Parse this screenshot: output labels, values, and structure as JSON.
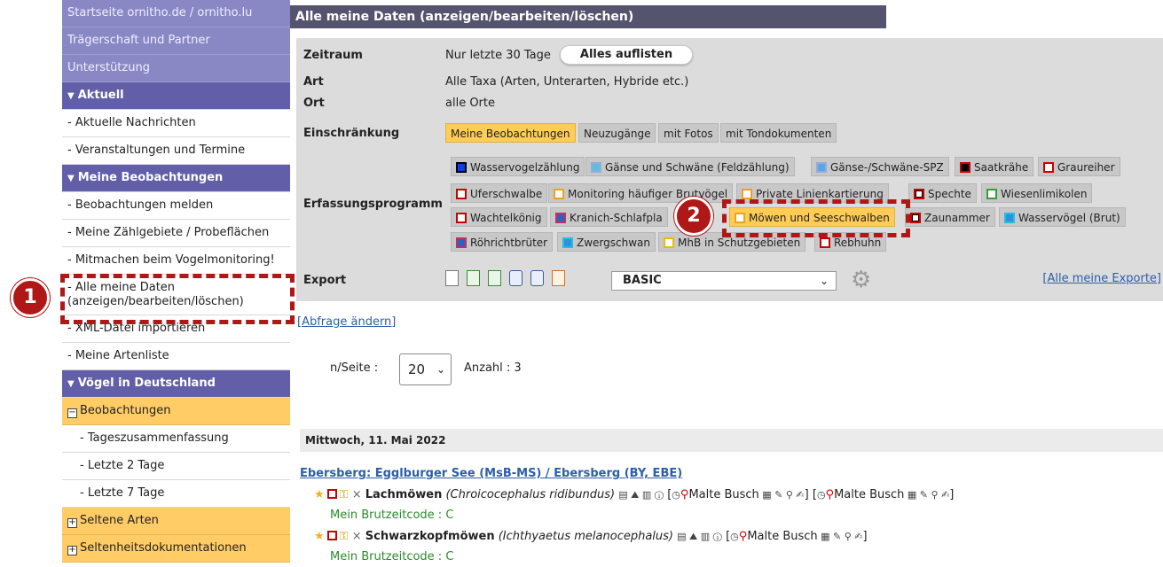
{
  "sidebar": {
    "top_items": [
      "Startseite ornitho.de / ornitho.lu",
      "Trägerschaft und Partner",
      "Unterstützung"
    ],
    "aktuell": {
      "heading": "Aktuell",
      "items": [
        "- Aktuelle Nachrichten",
        "- Veranstaltungen und Termine"
      ]
    },
    "meine": {
      "heading": "Meine Beobachtungen",
      "items": [
        "- Beobachtungen melden",
        "- Meine Zählgebiete / Probeflächen",
        "- Mitmachen beim Vogelmonitoring!",
        "- Alle meine Daten",
        "(anzeigen/bearbeiten/löschen)",
        "- XML-Datei importieren",
        "- Meine Artenliste"
      ]
    },
    "voegel": {
      "heading": "Vögel in Deutschland",
      "beobachtungen": "Beobachtungen",
      "items": [
        "- Tageszusammenfassung",
        "- Letzte 2 Tage",
        "- Letzte 7 Tage"
      ],
      "seltene": "Seltene Arten",
      "seltenheit": "Seltenheitsdokumentationen"
    }
  },
  "main": {
    "title": "Alle meine Daten (anzeigen/bearbeiten/löschen)",
    "filters": {
      "zeitraum_label": "Zeitraum",
      "zeitraum_value": "Nur letzte 30 Tage",
      "zeitraum_button": "Alles auflisten",
      "art_label": "Art",
      "art_value": "Alle Taxa (Arten, Unterarten, Hybride etc.)",
      "ort_label": "Ort",
      "ort_value": "alle Orte",
      "einschraenkung_label": "Einschränkung",
      "einschraenkung_options": [
        "Meine Beobachtungen",
        "Neuzugänge",
        "mit Fotos",
        "mit Tondokumenten"
      ],
      "einschraenkung_active": "Meine Beobachtungen",
      "erfassung_label": "Erfassungsprogramm",
      "programs": {
        "row1": [
          "Wasservogelzählung",
          "Gänse und Schwäne (Feldzählung)",
          "Gänse-/Schwäne-SPZ",
          "Saatkrähe",
          "Graureiher"
        ],
        "row2": [
          "Uferschwalbe",
          "Monitoring häufiger Brutvögel",
          "Private Linienkartierung",
          "Spechte",
          "Wiesenlimikolen"
        ],
        "row3": [
          "Wachtelkönig",
          "Kranich-Schlafpla",
          "Möwen und Seeschwalben",
          "Zaunammer",
          "Wasservögel (Brut)"
        ],
        "row4": [
          "Röhrichtbrüter",
          "Zwergschwan",
          "MhB in Schutzgebieten",
          "Rebhuhn"
        ]
      },
      "program_active": "Möwen und Seeschwalben",
      "export_label": "Export",
      "export_format": "BASIC",
      "all_exports_link": "[Alle meine Exporte]"
    },
    "abfrage_link": "[Abfrage ändern]",
    "per_page_label": "n/Seite :",
    "per_page_value": "20",
    "count_label": "Anzahl : 3",
    "date_header": "Mittwoch, 11. Mai 2022",
    "location": "Ebersberg: Egglburger See (MsB-MS) / Ebersberg (BY, EBE)",
    "observations": [
      {
        "name": "Lachmöwen",
        "scientific": "(Chroicocephalus ridibundus)",
        "observers": [
          "Malte Busch",
          "Malte Busch"
        ],
        "brutzeitcode": "Mein Brutzeitcode : C"
      },
      {
        "name": "Schwarzkopfmöwen",
        "scientific": "(Ichthyaetus melanocephalus)",
        "observers": [
          "Malte Busch"
        ],
        "brutzeitcode": "Mein Brutzeitcode : C"
      }
    ]
  },
  "callouts": [
    "1",
    "2"
  ],
  "colors": {
    "accent": "#625fa8",
    "highlight": "#ffcc55",
    "callout": "#b01818",
    "link": "#2d5ea8"
  }
}
